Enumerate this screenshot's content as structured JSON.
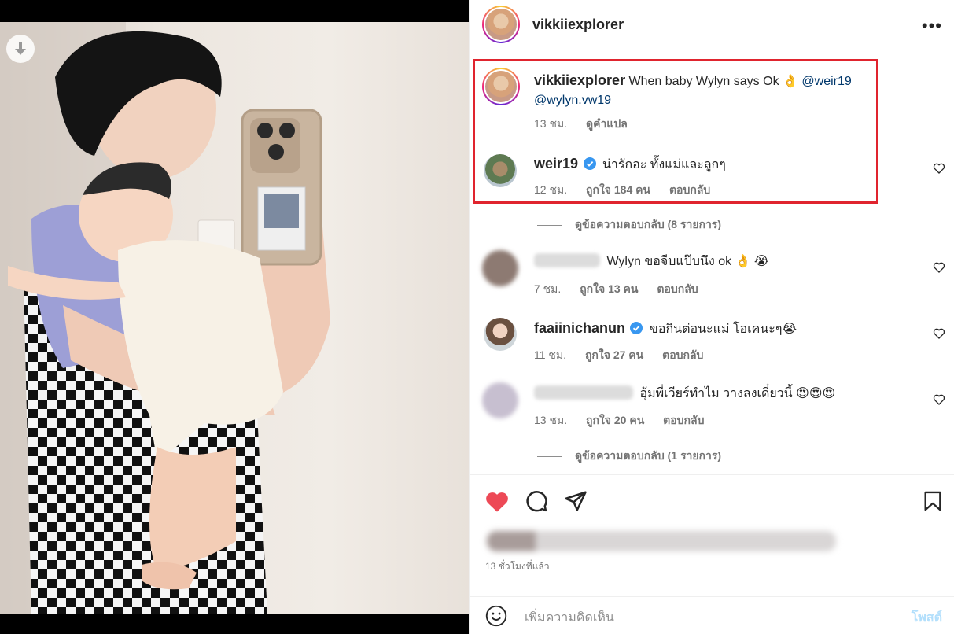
{
  "post": {
    "author": "vikkiiexplorer",
    "more_icon": "more-horizontal-icon",
    "caption": {
      "username": "vikkiiexplorer",
      "text": "When baby Wylyn says Ok 👌",
      "mentions": [
        "@weir19",
        "@wylyn.vw19"
      ],
      "time": "13 ชม.",
      "translate": "ดูคำแปล"
    },
    "comments": [
      {
        "username": "weir19",
        "verified": true,
        "text": "น่ารักอะ ทั้งแม่และลูกๆ",
        "time": "12 ชม.",
        "likes": "ถูกใจ 184 คน",
        "reply": "ตอบกลับ",
        "view_replies": "ดูข้อความตอบกลับ (8 รายการ)"
      },
      {
        "username": "",
        "text": "Wylyn ขอจีบแป๊บนึง ok 👌 😭",
        "time": "7 ชม.",
        "likes": "ถูกใจ 13 คน",
        "reply": "ตอบกลับ"
      },
      {
        "username": "faaiinichanun",
        "verified": true,
        "text": "ขอกินต่อนะแม่ โอเคนะๆ😭",
        "time": "11 ชม.",
        "likes": "ถูกใจ 27 คน",
        "reply": "ตอบกลับ"
      },
      {
        "username": "",
        "text": "อุ้มพี่เวียร์ทำไม วางลงเดี๋ยวนี้ 😍😍😍",
        "time": "13 ชม.",
        "likes": "ถูกใจ 20 คน",
        "reply": "ตอบกลับ",
        "view_replies": "ดูข้อความตอบกลับ (1 รายการ)"
      }
    ],
    "posted_ago": "13 ชั่วโมงที่แล้ว",
    "liked": true
  },
  "composer": {
    "placeholder": "เพิ่มความคิดเห็น",
    "post_label": "โพสต์"
  },
  "colors": {
    "like_red": "#ed4956",
    "highlight_box": "#e0242e",
    "link": "#00376b",
    "post_disabled": "#b2dffc"
  }
}
